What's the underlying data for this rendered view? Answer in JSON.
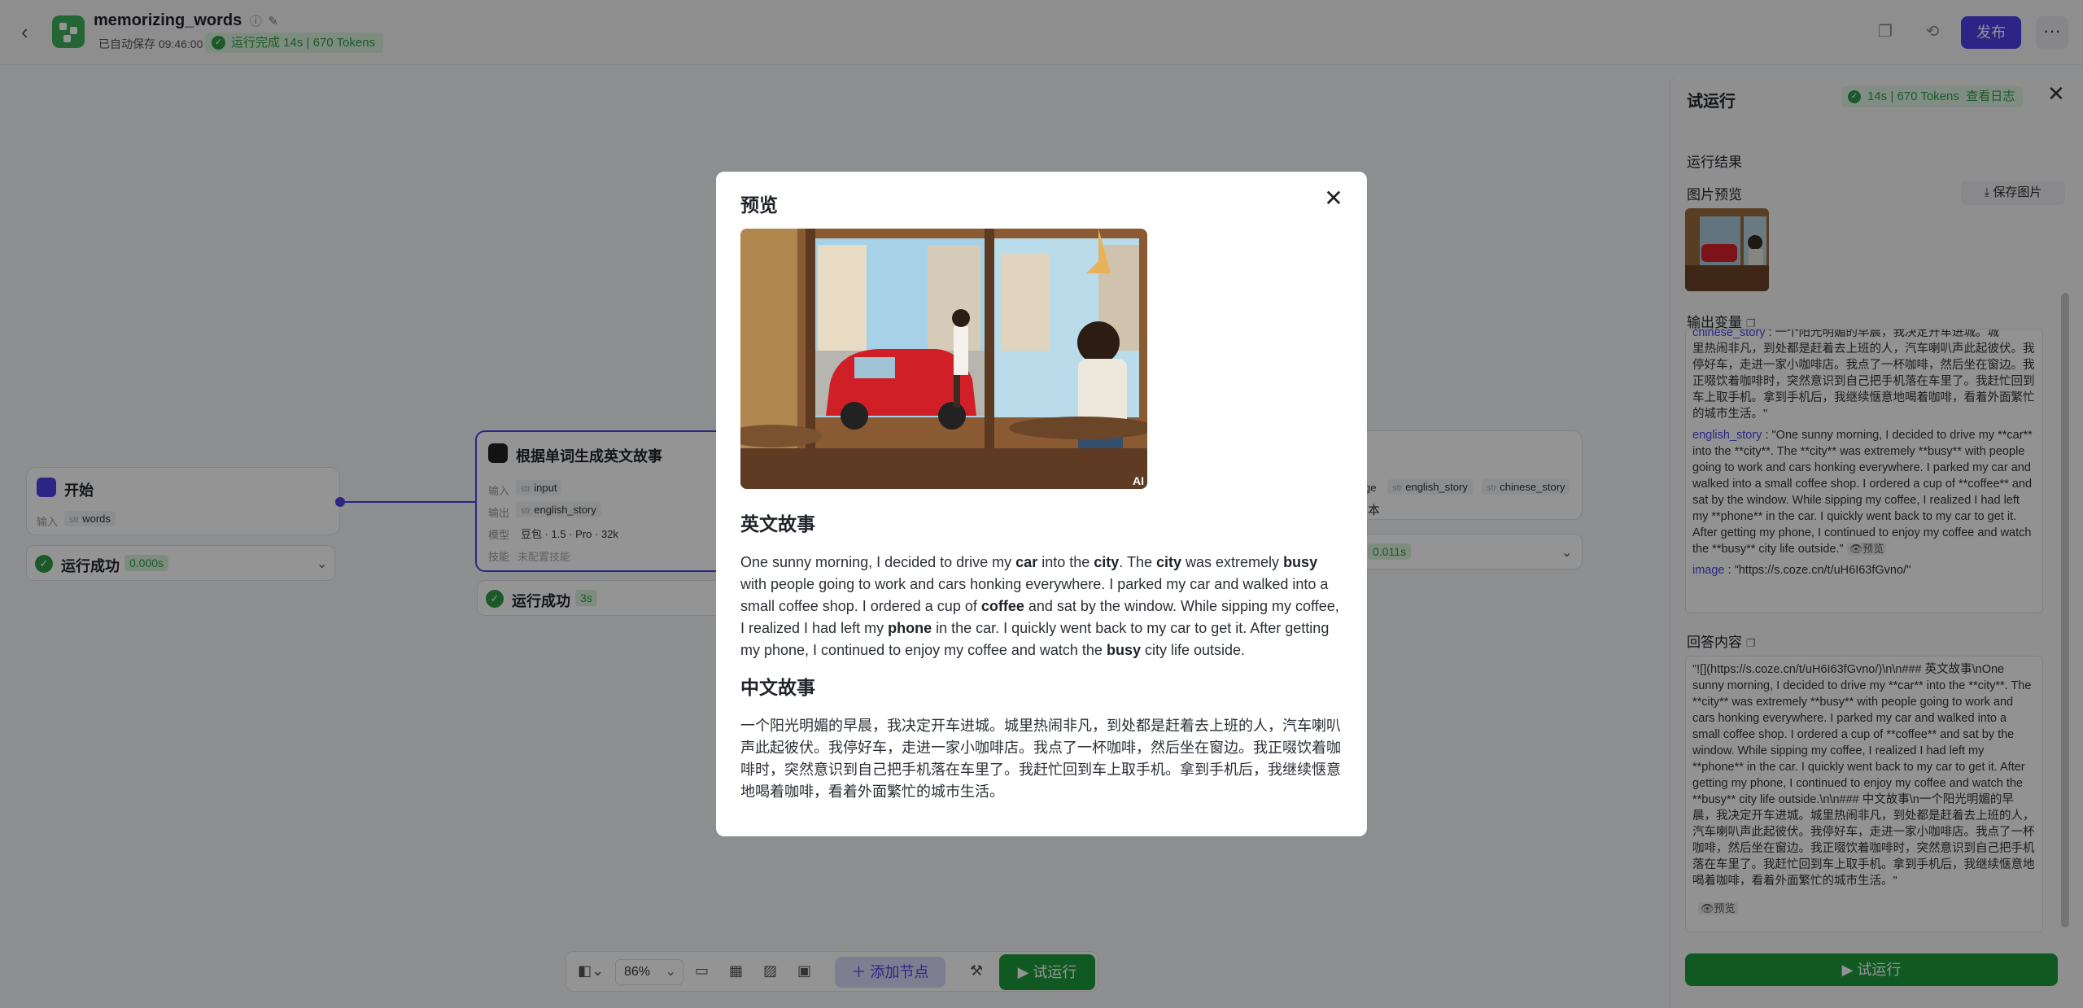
{
  "header": {
    "app_name": "memorizing_words",
    "autosave": "已自动保存 09:46:00",
    "run_status": "运行完成 14s | 670 Tokens",
    "publish_label": "发布",
    "more_label": "···"
  },
  "canvas": {
    "start_node": {
      "title": "开始",
      "input_label": "输入",
      "input_tag_type": "str",
      "input_tag": "words",
      "status": "运行成功",
      "time": "0.000s"
    },
    "llm_node": {
      "title": "根据单词生成英文故事",
      "input_label": "输入",
      "input_tag_type": "str",
      "input_tag": "input",
      "output_label": "输出",
      "output_tag_type": "str",
      "output_tag": "english_story",
      "model_label": "模型",
      "model_value": "豆包 · 1.5 · Pro · 32k",
      "skill_label": "技能",
      "skill_value": "未配置技能",
      "status": "运行成功",
      "time": "3s"
    },
    "right_node": {
      "tag_partial": "ge",
      "tag1_type": "str",
      "tag1": "english_story",
      "tag2_type": "str",
      "tag2": "chinese_story",
      "partial_text": "本",
      "time": "0.011s"
    }
  },
  "toolbar": {
    "zoom": "86%",
    "add_node": "添加节点",
    "trial_run": "试运行"
  },
  "panel": {
    "title": "试运行",
    "badge": "14s | 670 Tokens",
    "view_log": "查看日志",
    "result_title": "运行结果",
    "image_preview": "图片预览",
    "save_image": "保存图片",
    "output_vars": "输出变量",
    "chinese_name": "chinese_story",
    "chinese_partial_top": "一个阳光明媚的早晨，我决定开车进城。城",
    "chinese_value": "里热闹非凡，到处都是赶着去上班的人，汽车喇叭声此起彼伏。我停好车，走进一家小咖啡店。我点了一杯咖啡，然后坐在窗边。我正啜饮着咖啡时，突然意识到自己把手机落在车里了。我赶忙回到车上取手机。拿到手机后，我继续惬意地喝着咖啡，看着外面繁忙的城市生活。\"",
    "english_name": "english_story",
    "english_value": "\"One sunny morning, I decided to drive my **car** into the **city**. The **city** was extremely **busy** with people going to work and cars honking everywhere. I parked my car and walked into a small coffee shop. I ordered a cup of **coffee** and sat by the window. While sipping my coffee, I realized I had left my **phone** in the car. I quickly went back to my car to get it. After getting my phone, I continued to enjoy my coffee and watch the **busy** city life outside.\"",
    "preview_label": "预览",
    "image_name": "image",
    "image_value": "\"https://s.coze.cn/t/uH6I63fGvno/\"",
    "answer_title": "回答内容",
    "answer_value": "\"![](https://s.coze.cn/t/uH6I63fGvno/)\\n\\n### 英文故事\\nOne sunny morning, I decided to drive my **car** into the **city**. The **city** was extremely **busy** with people going to work and cars honking everywhere. I parked my car and walked into a small coffee shop. I ordered a cup of **coffee** and sat by the window. While sipping my coffee, I realized I had left my **phone** in the car. I quickly went back to my car to get it. After getting my phone, I continued to enjoy my coffee and watch the **busy** city life outside.\\n\\n### 中文故事\\n一个阳光明媚的早晨，我决定开车进城。城里热闹非凡，到处都是赶着去上班的人，汽车喇叭声此起彼伏。我停好车，走进一家小咖啡店。我点了一杯咖啡，然后坐在窗边。我正啜饮着咖啡时，突然意识到自己把手机落在车里了。我赶忙回到车上取手机。拿到手机后，我继续惬意地喝着咖啡，看着外面繁忙的城市生活。\"",
    "trial_run": "试运行"
  },
  "modal": {
    "title": "预览",
    "image_badge": "AI",
    "english_heading": "英文故事",
    "chinese_heading": "中文故事",
    "chinese_story": "一个阳光明媚的早晨，我决定开车进城。城里热闹非凡，到处都是赶着去上班的人，汽车喇叭声此起彼伏。我停好车，走进一家小咖啡店。我点了一杯咖啡，然后坐在窗边。我正啜饮着咖啡时，突然意识到自己把手机落在车里了。我赶忙回到车上取手机。拿到手机后，我继续惬意地喝着咖啡，看着外面繁忙的城市生活。",
    "english_segments": [
      {
        "t": "One sunny morning, I decided to drive my ",
        "b": false
      },
      {
        "t": "car",
        "b": true
      },
      {
        "t": " into the ",
        "b": false
      },
      {
        "t": "city",
        "b": true
      },
      {
        "t": ". The ",
        "b": false
      },
      {
        "t": "city",
        "b": true
      },
      {
        "t": " was extremely ",
        "b": false
      },
      {
        "t": "busy",
        "b": true
      },
      {
        "t": " with people going to work and cars honking everywhere. I parked my car and walked into a small coffee shop. I ordered a cup of ",
        "b": false
      },
      {
        "t": "coffee",
        "b": true
      },
      {
        "t": " and sat by the window. While sipping my coffee, I realized I had left my ",
        "b": false
      },
      {
        "t": "phone",
        "b": true
      },
      {
        "t": " in the car. I quickly went back to my car to get it. After getting my phone, I continued to enjoy my coffee and watch the ",
        "b": false
      },
      {
        "t": "busy",
        "b": true
      },
      {
        "t": " city life outside.",
        "b": false
      }
    ]
  },
  "colors": {
    "accent": "#4e40e5",
    "success": "#1e9a3c",
    "brand_green": "#3fae5a"
  }
}
